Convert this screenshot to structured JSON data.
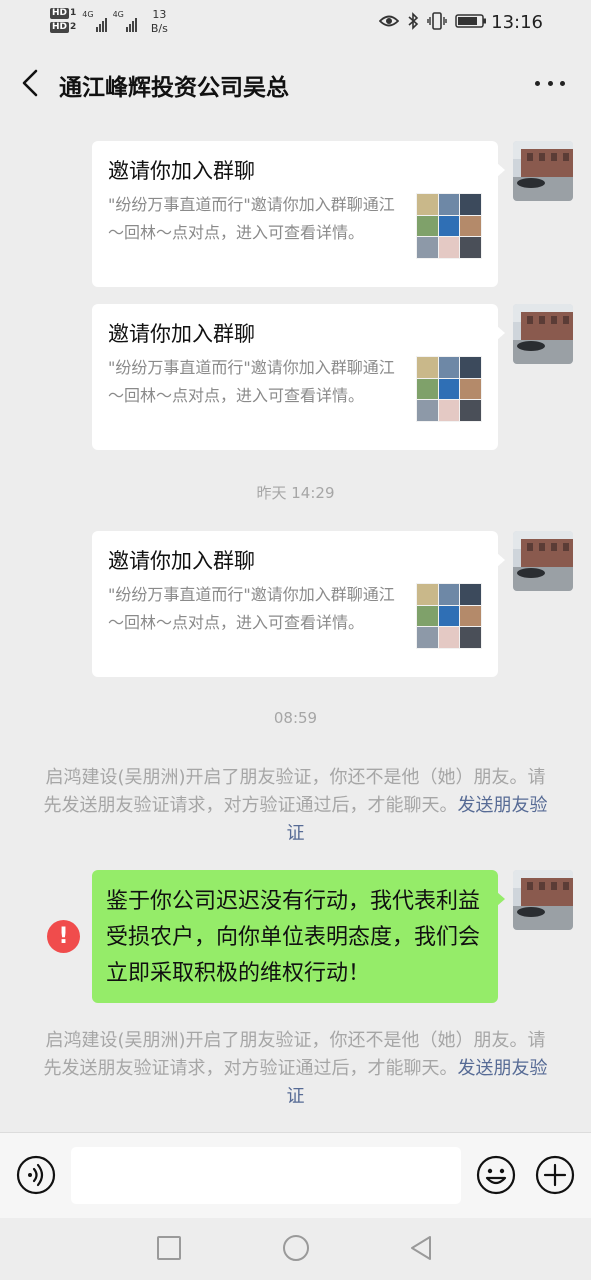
{
  "status_bar": {
    "hd1": "HD",
    "hd1_sub": "1",
    "hd2": "HD",
    "hd2_sub": "2",
    "net1": "4G",
    "net2": "4G",
    "speed_value": "13",
    "speed_unit": "B/s",
    "time": "13:16"
  },
  "header": {
    "title": "通江峰辉投资公司吴总"
  },
  "messages": [
    {
      "type": "invite",
      "title": "邀请你加入群聊",
      "description": "\"纷纷万事直道而行\"邀请你加入群聊通江～回林～点对点，进入可查看详情。"
    },
    {
      "type": "invite",
      "title": "邀请你加入群聊",
      "description": "\"纷纷万事直道而行\"邀请你加入群聊通江～回林～点对点，进入可查看详情。"
    },
    {
      "type": "timestamp",
      "text": "昨天 14:29"
    },
    {
      "type": "invite",
      "title": "邀请你加入群聊",
      "description": "\"纷纷万事直道而行\"邀请你加入群聊通江～回林～点对点，进入可查看详情。"
    },
    {
      "type": "timestamp",
      "text": "08:59"
    },
    {
      "type": "system",
      "text": "启鸿建设(吴朋洲)开启了朋友验证，你还不是他（她）朋友。请先发送朋友验证请求，对方验证通过后，才能聊天。",
      "link": "发送朋友验证"
    },
    {
      "type": "text",
      "status": "failed",
      "status_symbol": "!",
      "text": "鉴于你公司迟迟没有行动，我代表利益受损农户，向你单位表明态度，我们会立即采取积极的维权行动！"
    },
    {
      "type": "system",
      "text": "启鸿建设(吴朋洲)开启了朋友验证，你还不是他（她）朋友。请先发送朋友验证请求，对方验证通过后，才能聊天。",
      "link": "发送朋友验证"
    }
  ],
  "input_bar": {
    "text_value": ""
  },
  "icons": {
    "back": "chevron-left-icon",
    "more": "more-dots-icon",
    "voice": "voice-icon",
    "emoji": "emoji-icon",
    "plus": "plus-icon",
    "failed": "error-icon"
  },
  "colors": {
    "background": "#ededed",
    "sent_bubble": "#95ec69",
    "link": "#576b95",
    "failed": "#f04c4c",
    "system_text": "#a6a6a6"
  }
}
